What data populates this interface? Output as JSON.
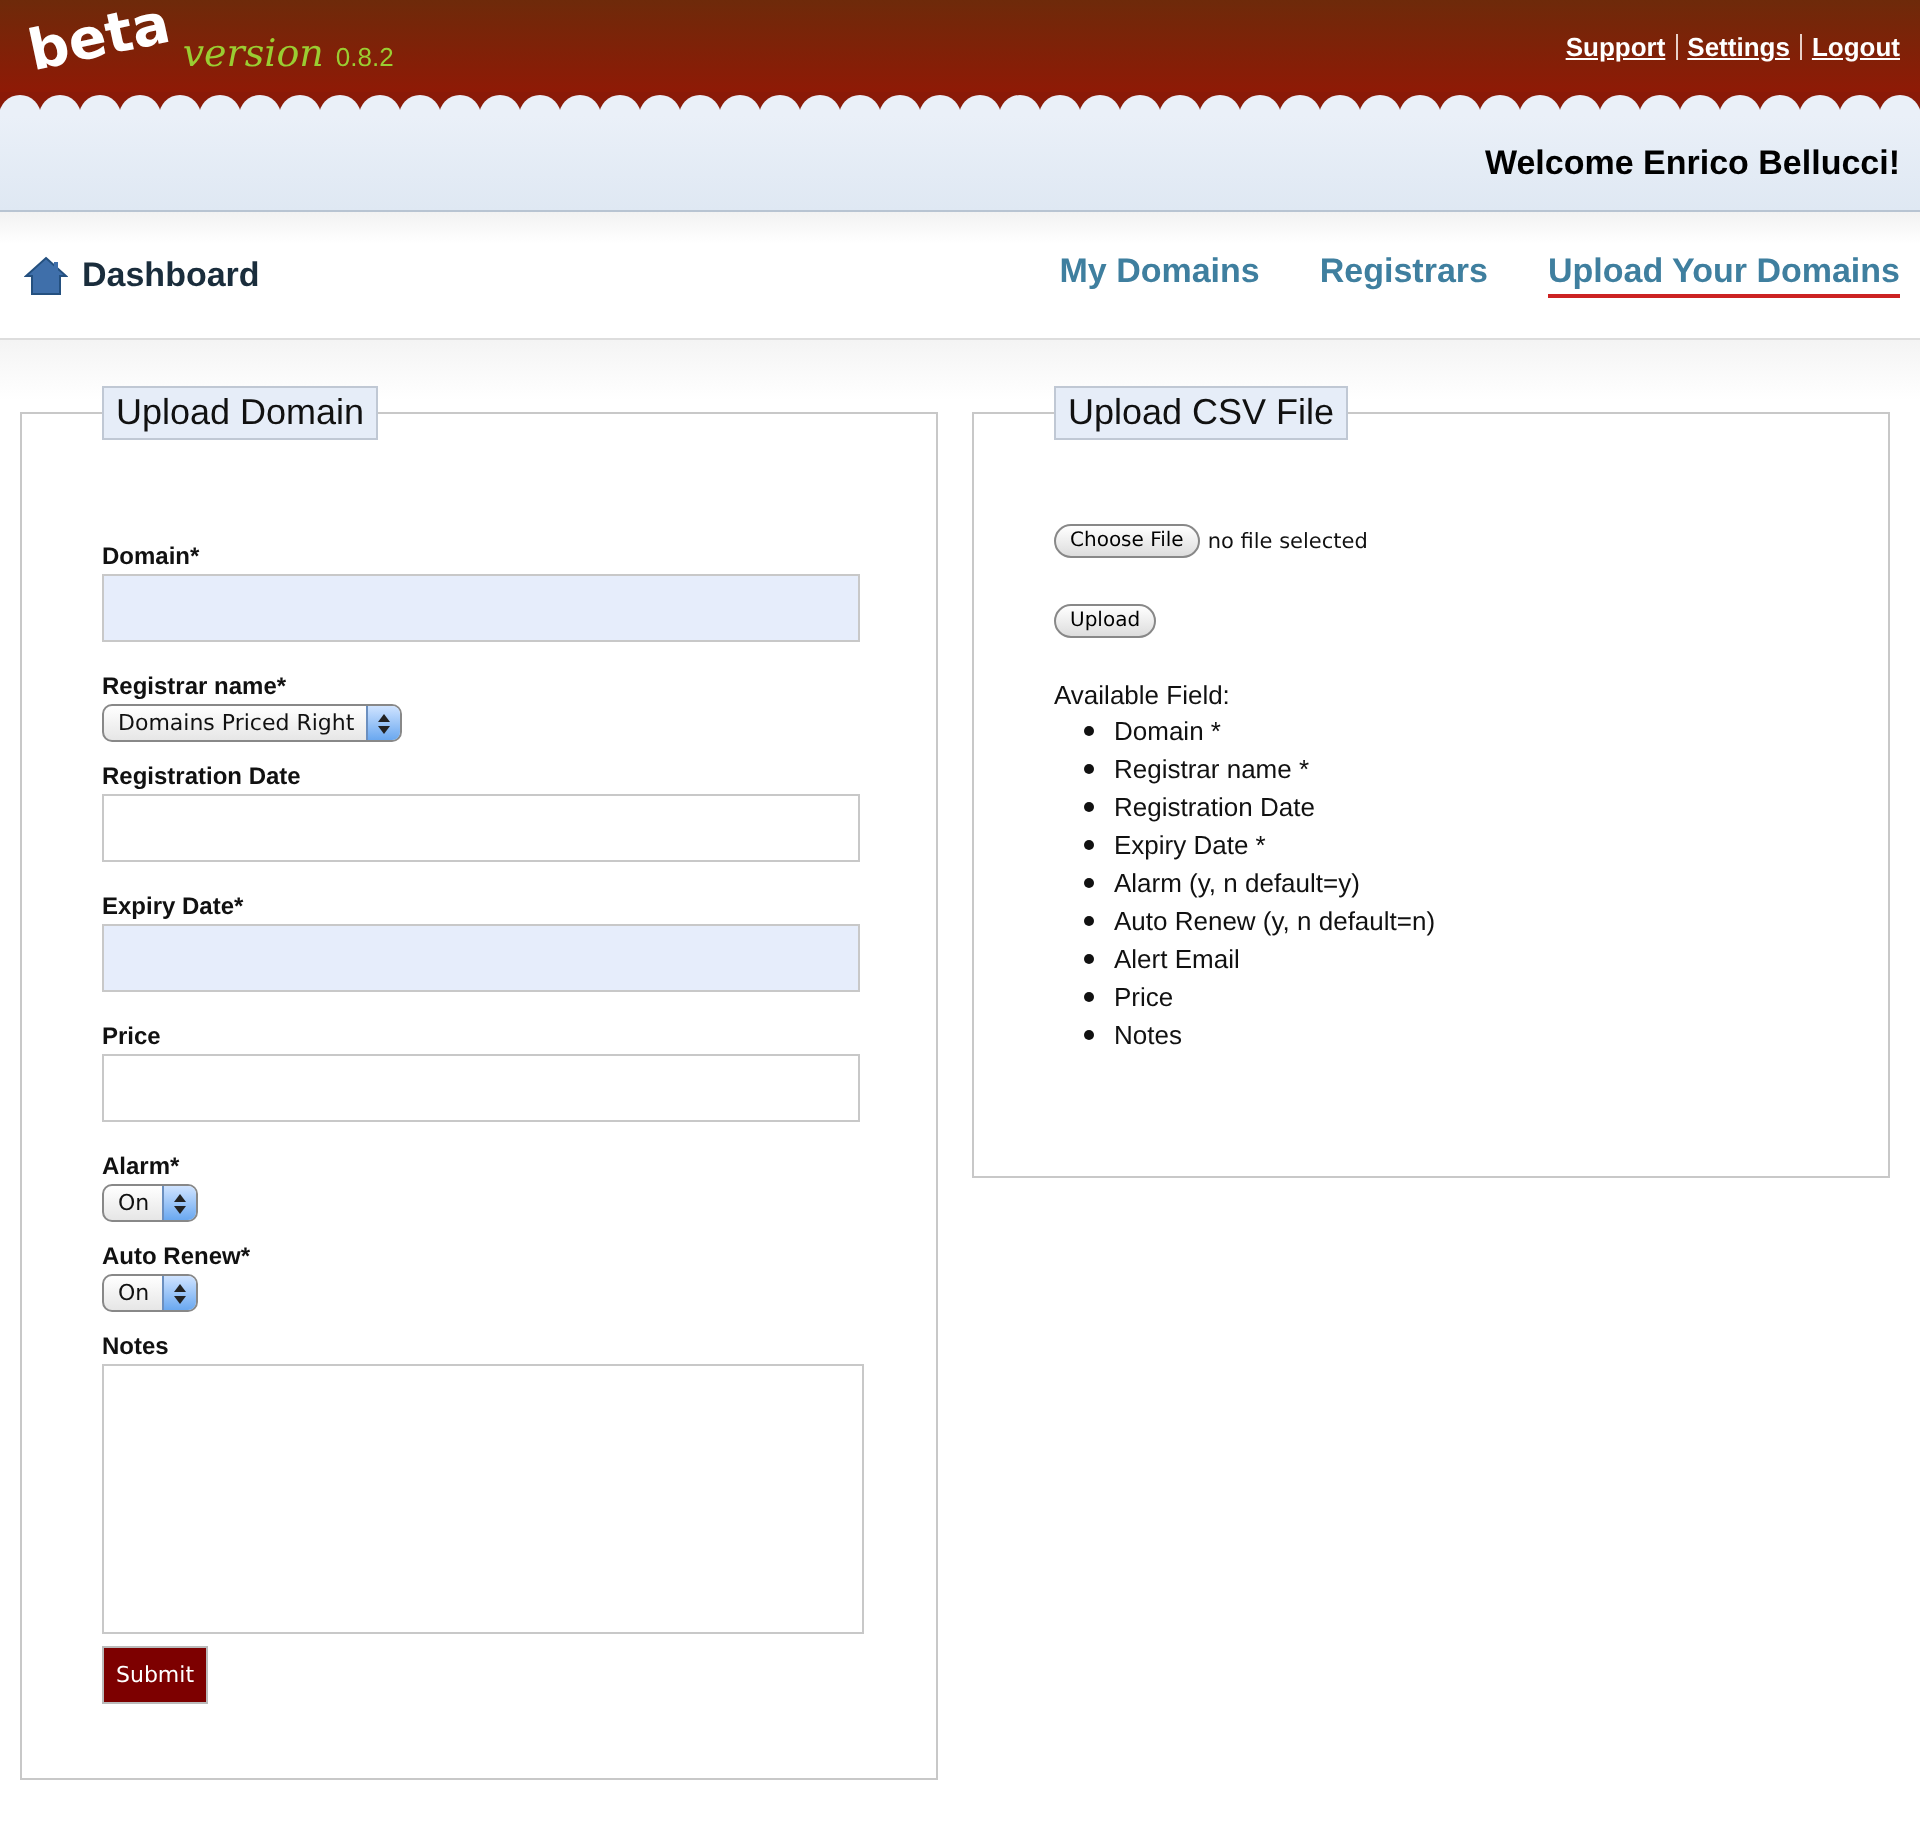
{
  "logo": {
    "word": "beta",
    "tagline": "version",
    "version": "0.8.2"
  },
  "top_links": [
    "Support",
    "Settings",
    "Logout"
  ],
  "welcome": "Welcome Enrico Bellucci!",
  "breadcrumb": "Dashboard",
  "nav": [
    {
      "label": "My Domains",
      "selected": false
    },
    {
      "label": "Registrars",
      "selected": false
    },
    {
      "label": "Upload Your Domains",
      "selected": true
    }
  ],
  "upload_domain": {
    "title": "Upload Domain",
    "fields": [
      {
        "kind": "text",
        "label": "Domain*",
        "highlighted": true
      },
      {
        "kind": "select",
        "label": "Registrar name*",
        "value": "Domains Priced Right"
      },
      {
        "kind": "text",
        "label": "Registration Date",
        "highlighted": false
      },
      {
        "kind": "text",
        "label": "Expiry Date*",
        "highlighted": true
      },
      {
        "kind": "text",
        "label": "Price",
        "highlighted": false
      },
      {
        "kind": "select",
        "label": "Alarm*",
        "value": "On"
      },
      {
        "kind": "select",
        "label": "Auto Renew*",
        "value": "On"
      },
      {
        "kind": "textarea",
        "label": "Notes"
      }
    ],
    "submit": "Submit"
  },
  "upload_csv": {
    "title": "Upload CSV File",
    "choose_button": "Choose File",
    "file_status": "no file selected",
    "upload_button": "Upload",
    "fields_heading": "Available Field:",
    "fields": [
      "Domain *",
      "Registrar name *",
      "Registration Date",
      "Expiry Date *",
      "Alarm (y, n default=y)",
      "Auto Renew (y, n default=n)",
      "Alert Email",
      "Price",
      "Notes"
    ]
  }
}
